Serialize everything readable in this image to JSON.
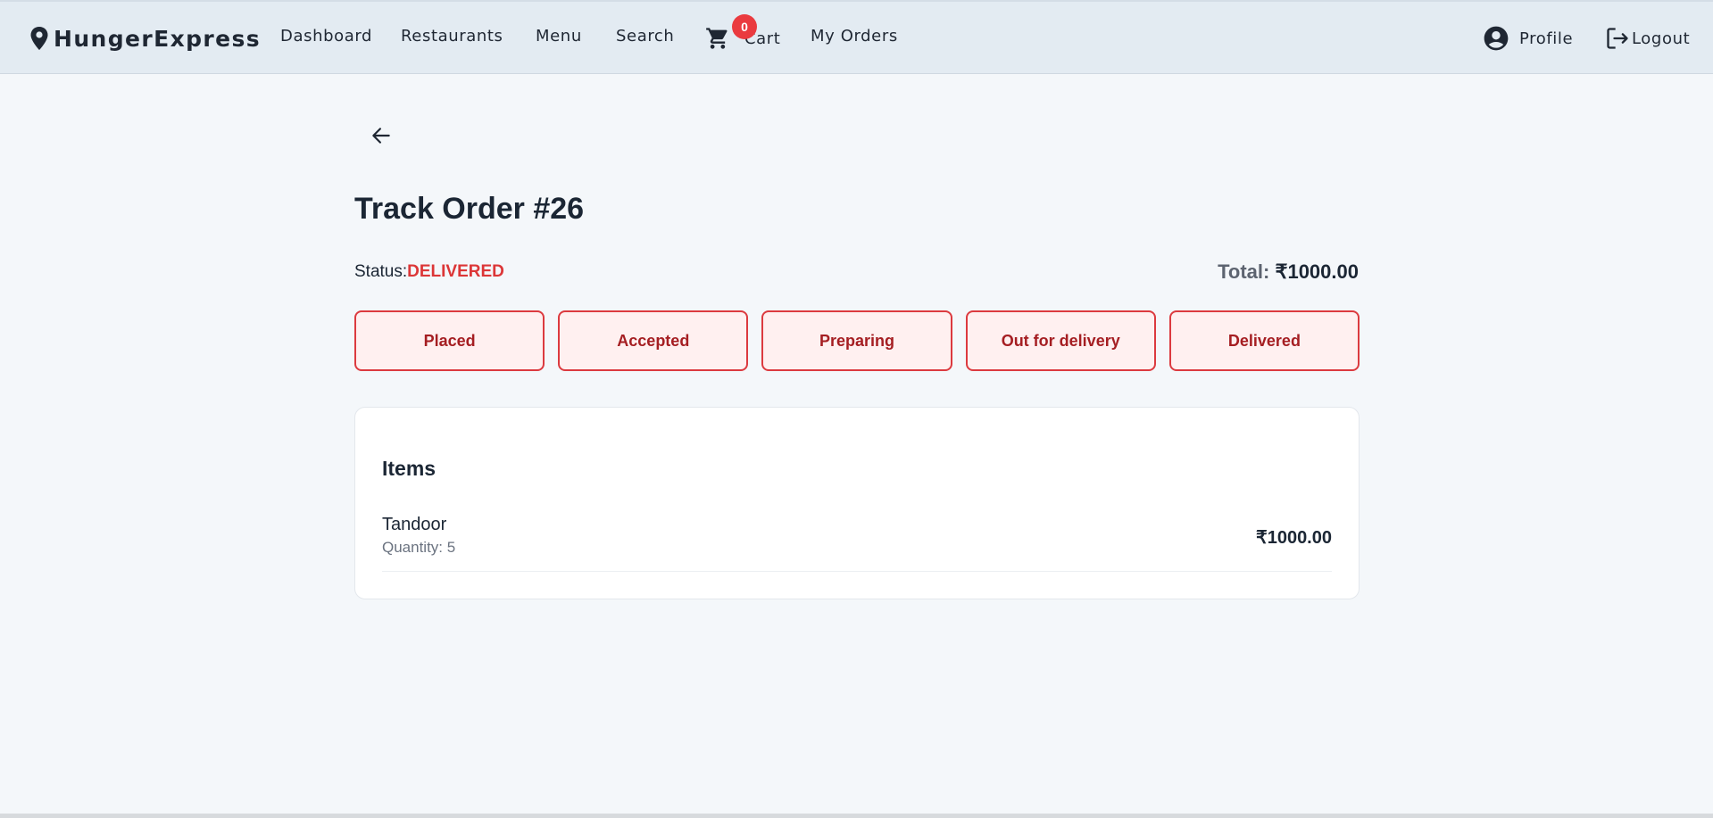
{
  "nav": {
    "brand": "HungerExpress",
    "links": [
      "Dashboard",
      "Restaurants",
      "Menu",
      "Search"
    ],
    "cart_label": "Cart",
    "cart_count": "0",
    "my_orders": "My Orders",
    "profile": "Profile",
    "logout": "Logout",
    "icons": {
      "brand": "map-pin-icon",
      "cart": "shopping-cart-icon",
      "profile": "account-circle-icon",
      "logout": "logout-icon"
    }
  },
  "page": {
    "back_icon": "arrow-left-icon",
    "title": "Track Order #26",
    "status_label": "Status:",
    "status_value": "DELIVERED",
    "total_label": "Total:",
    "total_value": "₹1000.00",
    "steps": [
      "Placed",
      "Accepted",
      "Preparing",
      "Out for delivery",
      "Delivered"
    ],
    "items_title": "Items",
    "items": [
      {
        "name": "Tandoor",
        "quantity": "Quantity: 5",
        "price": "₹1000.00"
      }
    ]
  },
  "colors": {
    "accent_red": "#dc3637",
    "step_border": "#dc3a3f",
    "step_bg": "#fff0f0",
    "step_text": "#a51e22",
    "navbar_bg": "#e3ebf2",
    "page_bg": "#f4f7fa"
  }
}
